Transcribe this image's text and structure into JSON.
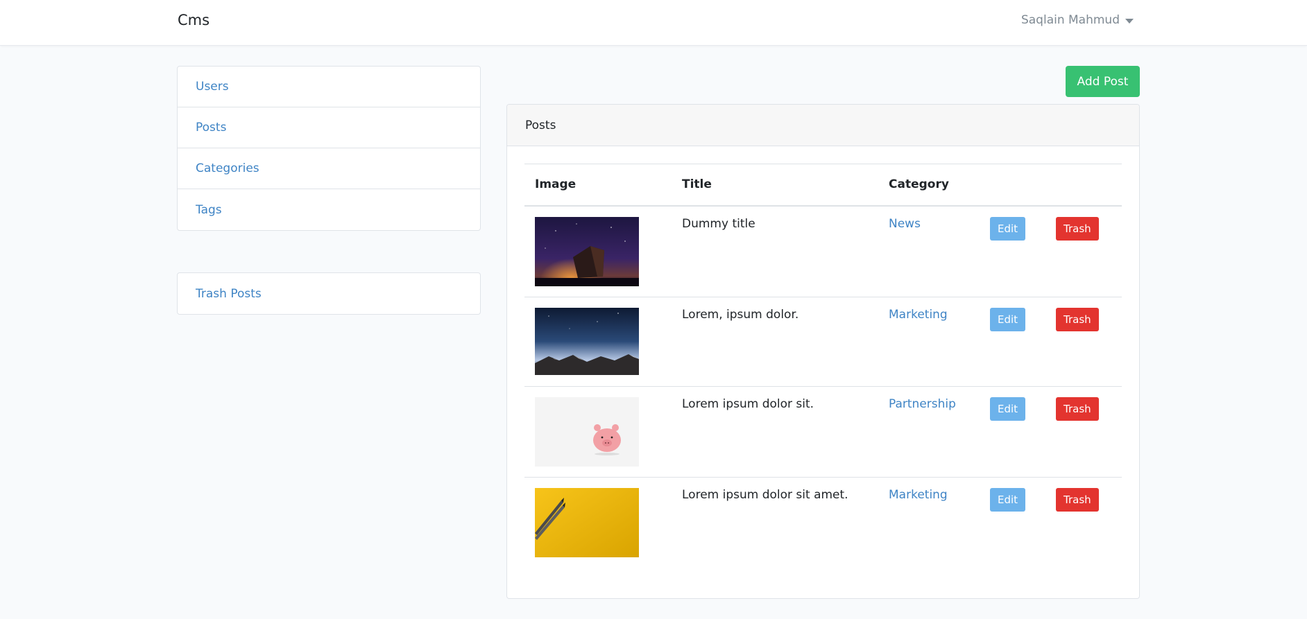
{
  "navbar": {
    "brand": "Cms",
    "user_name": "Saqlain Mahmud"
  },
  "sidebar": {
    "items": [
      {
        "label": "Users"
      },
      {
        "label": "Posts"
      },
      {
        "label": "Categories"
      },
      {
        "label": "Tags"
      }
    ],
    "trash_label": "Trash Posts"
  },
  "main": {
    "add_post_label": "Add Post",
    "card_title": "Posts",
    "table": {
      "headers": [
        "Image",
        "Title",
        "Category"
      ],
      "rows": [
        {
          "image": "ship-night-sky-image",
          "title": "Dummy title",
          "category": "News",
          "edit": "Edit",
          "trash": "Trash"
        },
        {
          "image": "mountain-starry-sky-image",
          "title": "Lorem, ipsum dolor.",
          "category": "Marketing",
          "edit": "Edit",
          "trash": "Trash"
        },
        {
          "image": "piggy-bank-image",
          "title": "Lorem ipsum dolor sit.",
          "category": "Partnership",
          "edit": "Edit",
          "trash": "Trash"
        },
        {
          "image": "pencils-yellow-image",
          "title": "Lorem ipsum dolor sit amet.",
          "category": "Marketing",
          "edit": "Edit",
          "trash": "Trash"
        }
      ]
    }
  },
  "colors": {
    "link": "#3f84c5",
    "success": "#38c172",
    "info": "#6cb2eb",
    "danger": "#e3342f"
  }
}
